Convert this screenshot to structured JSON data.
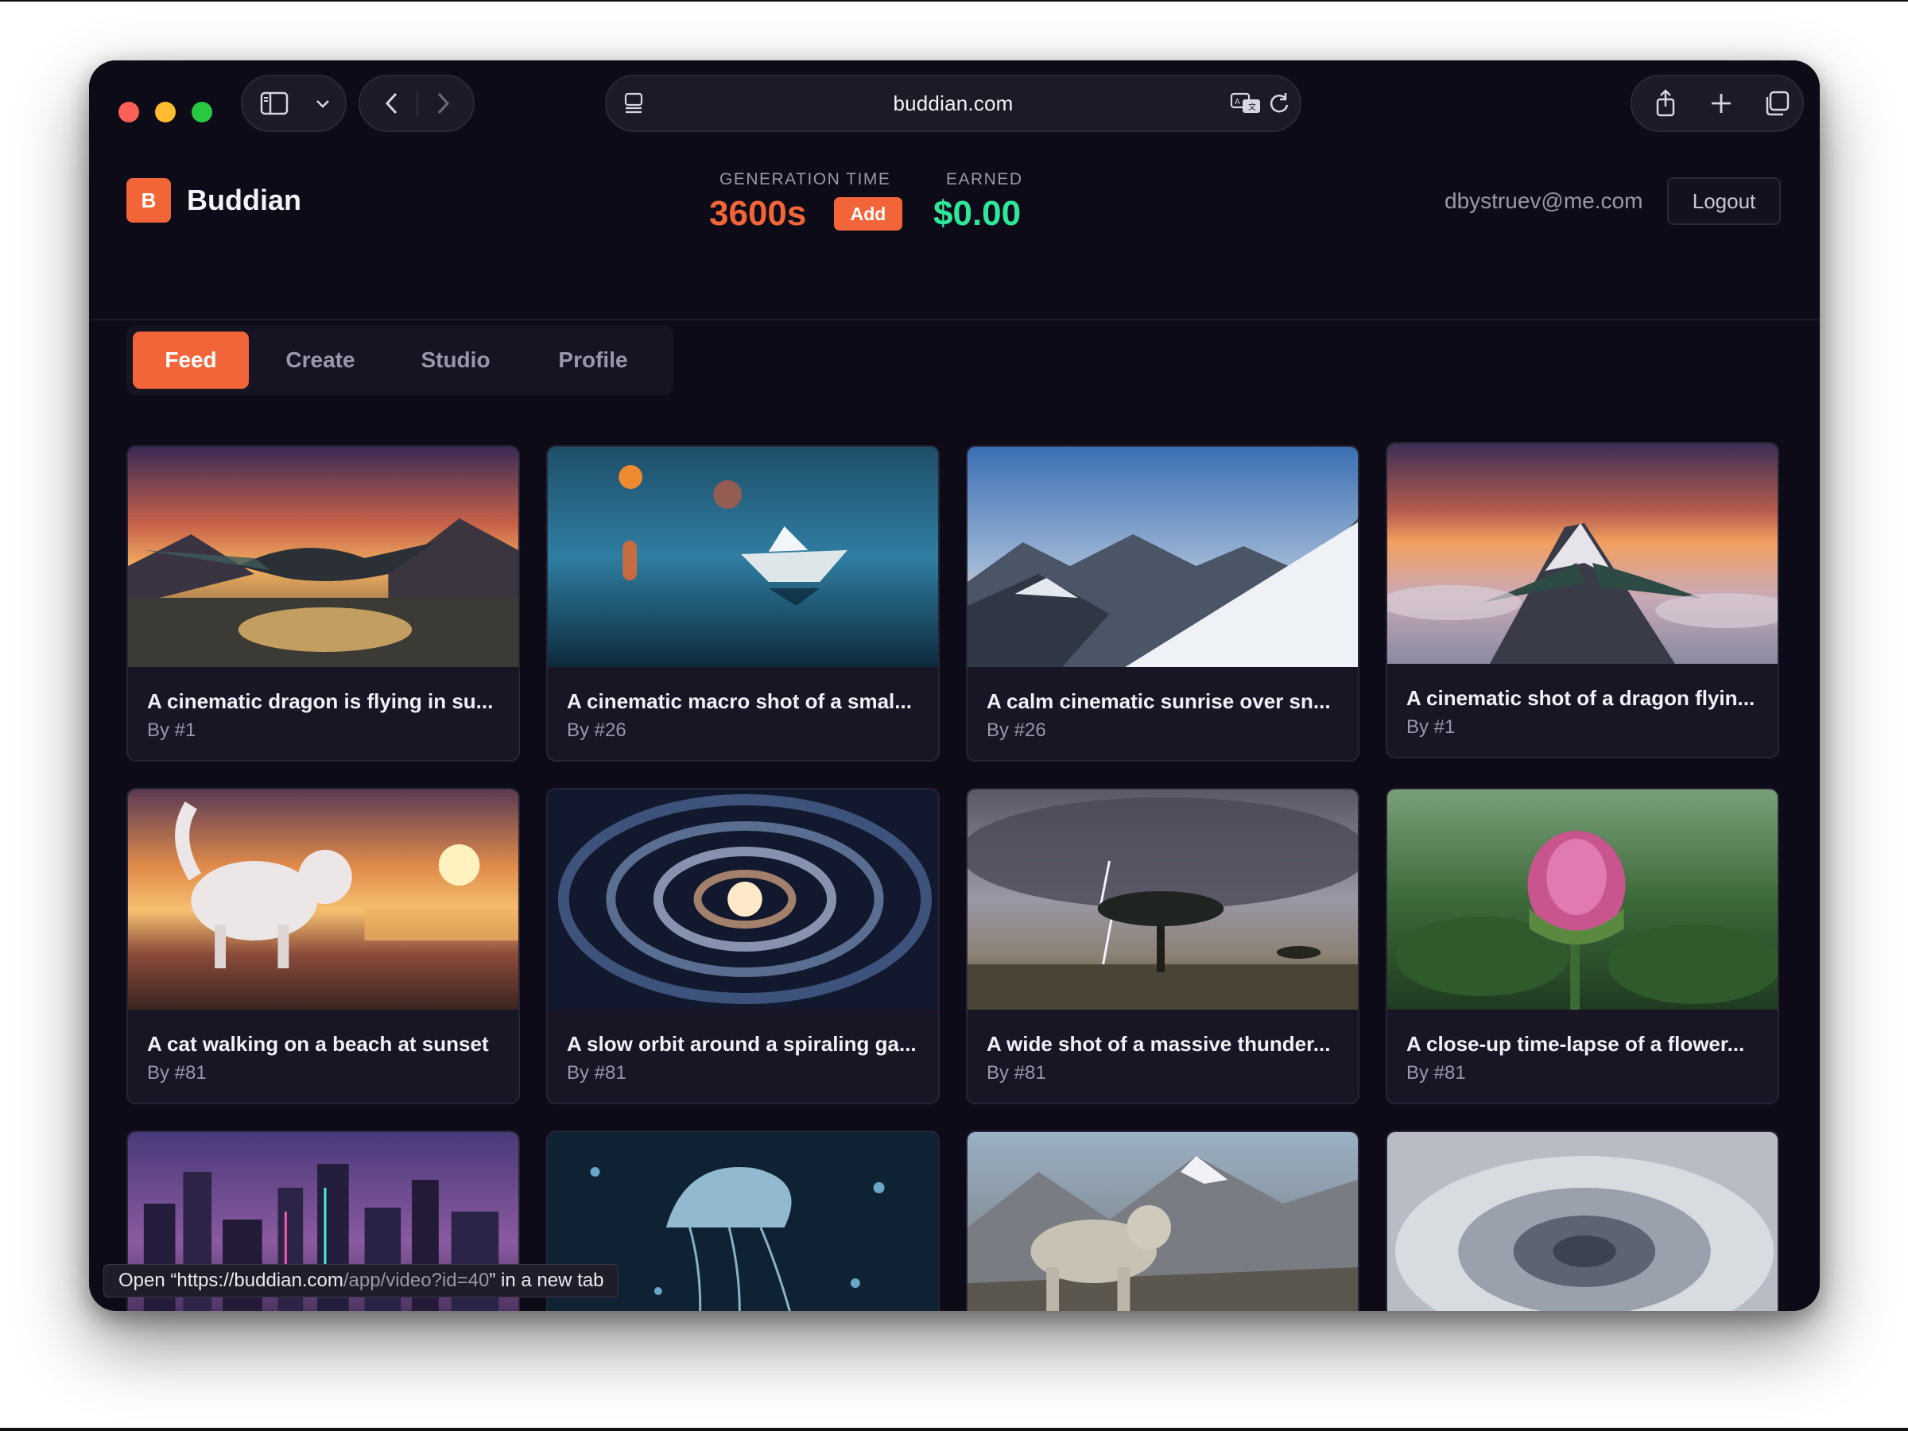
{
  "browser": {
    "url": "buddian.com",
    "status_tip_prefix": "Open “https://buddian.com",
    "status_tip_path": "/app/video?id=40",
    "status_tip_suffix": "” in a new tab"
  },
  "app": {
    "logo_letter": "B",
    "name": "Buddian",
    "generation_time_label": "GENERATION TIME",
    "generation_time_value": "3600s",
    "add_label": "Add",
    "earned_label": "EARNED",
    "earned_value": "$0.00",
    "user_email": "dbystruev@me.com",
    "logout_label": "Logout"
  },
  "tabs": [
    {
      "label": "Feed",
      "active": true
    },
    {
      "label": "Create",
      "active": false
    },
    {
      "label": "Studio",
      "active": false
    },
    {
      "label": "Profile",
      "active": false
    }
  ],
  "feed": [
    {
      "title": "A cinematic dragon is flying in su...",
      "author": "By #1",
      "scene": "dragon-sunset"
    },
    {
      "title": "A cinematic macro shot of a smal...",
      "author": "By #26",
      "scene": "paper-boat"
    },
    {
      "title": "A calm cinematic sunrise over sn...",
      "author": "By #26",
      "scene": "snowy-mountains"
    },
    {
      "title": "A cinematic shot of a dragon flyin...",
      "author": "By #1",
      "scene": "dragon-peak"
    },
    {
      "title": "A cat walking on a beach at sunset",
      "author": "By #81",
      "scene": "cat-beach"
    },
    {
      "title": "A slow orbit around a spiraling ga...",
      "author": "By #81",
      "scene": "galaxy"
    },
    {
      "title": "A wide shot of a massive thunder...",
      "author": "By #81",
      "scene": "thunderstorm"
    },
    {
      "title": "A close-up time-lapse of a flower...",
      "author": "By #81",
      "scene": "flower"
    },
    {
      "title": "",
      "author": "",
      "scene": "neon-city"
    },
    {
      "title": "",
      "author": "",
      "scene": "jellyfish"
    },
    {
      "title": "",
      "author": "",
      "scene": "snow-leopard"
    },
    {
      "title": "",
      "author": "",
      "scene": "cloud-vortex"
    }
  ]
}
